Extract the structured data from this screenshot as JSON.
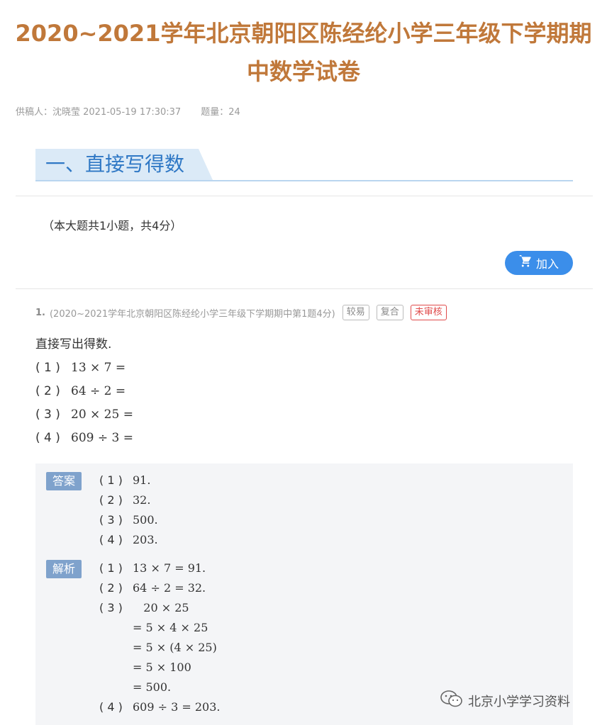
{
  "title": {
    "line1": "2020~2021学年北京朝阳区陈经纶小学三年级下学期期",
    "line2": "中数学试卷"
  },
  "meta": {
    "contributor": "供稿人：沈晓莹 2021-05-19 17:30:37",
    "question_count": "题量：24"
  },
  "section": {
    "title": "一、直接写得数",
    "summary": "（本大题共1小题，共4分）",
    "cart_label": "加入"
  },
  "question": {
    "number": "1.",
    "source": "(2020~2021学年北京朝阳区陈经纶小学三年级下学期期中第1题4分)",
    "tags": [
      "较易",
      "复合",
      "未审核"
    ],
    "stem": "直接写出得数.",
    "items": [
      {
        "idx": "( 1 )",
        "expr": "13 × 7 ="
      },
      {
        "idx": "( 2 )",
        "expr": "64 ÷ 2 ="
      },
      {
        "idx": "( 3 )",
        "expr": "20 × 25 ="
      },
      {
        "idx": "( 4 )",
        "expr": "609 ÷ 3 ="
      }
    ]
  },
  "answer": {
    "label": "答案",
    "rows": [
      {
        "idx": "( 1 )",
        "text": "91."
      },
      {
        "idx": "( 2 )",
        "text": "32."
      },
      {
        "idx": "( 3 )",
        "text": "500."
      },
      {
        "idx": "( 4 )",
        "text": "203."
      }
    ]
  },
  "analysis": {
    "label": "解析",
    "rows": [
      {
        "idx": "( 1 )",
        "text": "13 × 7 = 91."
      },
      {
        "idx": "( 2 )",
        "text": "64 ÷ 2 = 32."
      },
      {
        "idx": "( 3 )",
        "text": "   20 × 25"
      },
      {
        "idx": "",
        "text": "= 5 × 4 × 25"
      },
      {
        "idx": "",
        "text": "= 5 × (4 × 25)"
      },
      {
        "idx": "",
        "text": "= 5 × 100"
      },
      {
        "idx": "",
        "text": "= 500."
      },
      {
        "idx": "( 4 )",
        "text": "609 ÷ 3 = 203."
      }
    ]
  },
  "watermark": {
    "text": "北京小学学习资料",
    "icon": "wechat-icon"
  },
  "colors": {
    "title": "#c0783a",
    "section_title": "#2f78c5",
    "button": "#3b8eea",
    "badge": "#7fa2cc",
    "tag_red": "#e04b4b"
  }
}
